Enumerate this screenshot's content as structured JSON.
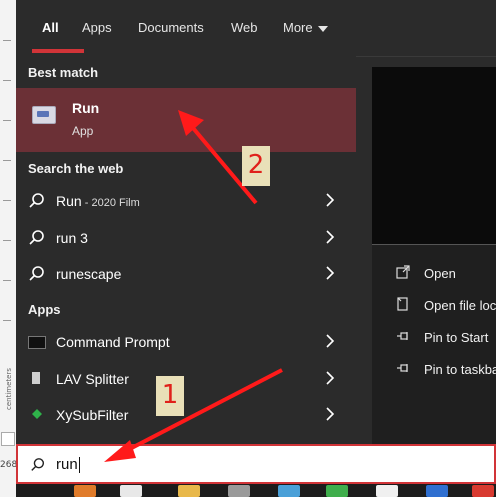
{
  "tabs": [
    {
      "label": "All",
      "active": true
    },
    {
      "label": "Apps"
    },
    {
      "label": "Documents"
    },
    {
      "label": "Web"
    },
    {
      "label": "More"
    }
  ],
  "best_match": {
    "section": "Best match",
    "title": "Run",
    "subtitle": "App",
    "icon": "run-app-icon"
  },
  "web": {
    "section": "Search the web",
    "items": [
      {
        "label": "Run",
        "suffix": " - 2020 Film"
      },
      {
        "label": "run 3",
        "suffix": ""
      },
      {
        "label": "runescape",
        "suffix": ""
      }
    ]
  },
  "apps": {
    "section": "Apps",
    "items": [
      {
        "label": "Command Prompt",
        "icon": "command-prompt-icon"
      },
      {
        "label": "LAV Splitter",
        "icon": "lav-splitter-icon"
      },
      {
        "label": "XySubFilter",
        "icon": "xysubfilter-icon"
      }
    ]
  },
  "actions": [
    {
      "label": "Open",
      "icon": "open-icon"
    },
    {
      "label": "Open file loc",
      "icon": "folder-icon"
    },
    {
      "label": "Pin to Start",
      "icon": "pin-icon"
    },
    {
      "label": "Pin to taskba",
      "icon": "pin-icon"
    }
  ],
  "search": {
    "value": "run"
  },
  "ruler": {
    "units": "centimeters",
    "coord": "268"
  },
  "annotations": {
    "badge1": "1",
    "badge2": "2"
  },
  "colors": {
    "accent": "#d13438",
    "highlight": "#6b3036",
    "arrow": "#ff1a1a"
  }
}
